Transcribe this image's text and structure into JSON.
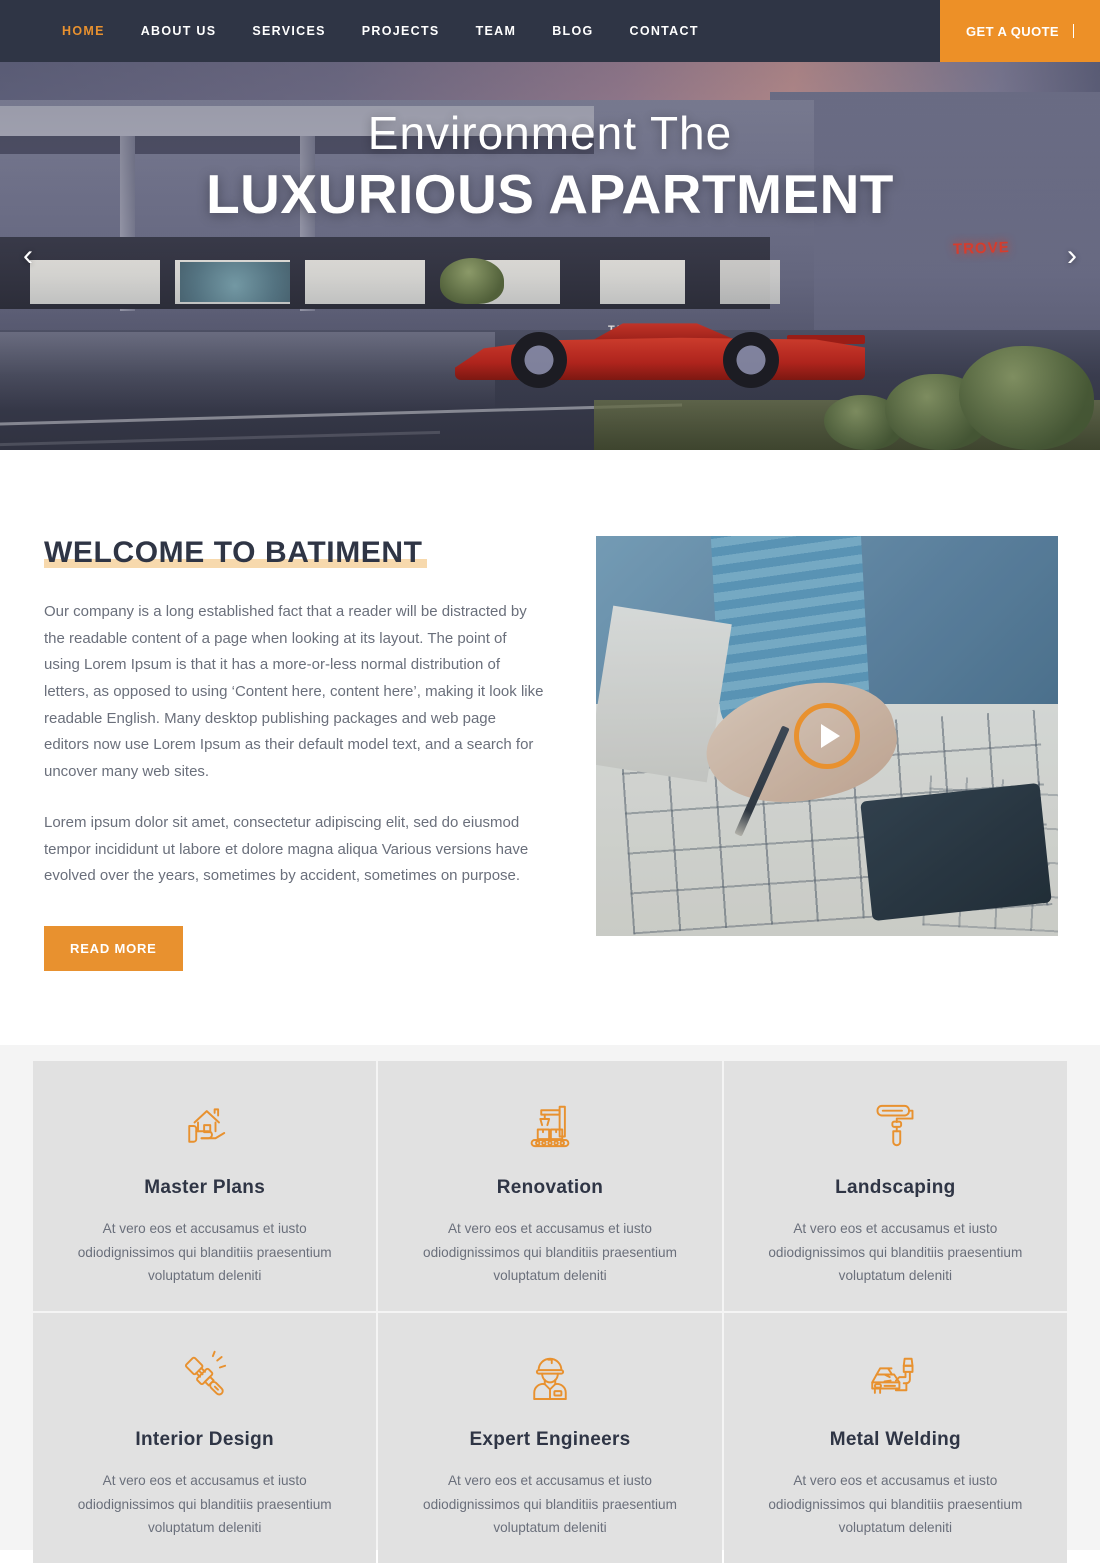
{
  "nav": {
    "items": [
      {
        "label": "HOME",
        "active": true
      },
      {
        "label": "ABOUT US",
        "active": false
      },
      {
        "label": "SERVICES",
        "active": false
      },
      {
        "label": "PROJECTS",
        "active": false
      },
      {
        "label": "TEAM",
        "active": false
      },
      {
        "label": "BLOG",
        "active": false
      },
      {
        "label": "CONTACT",
        "active": false
      }
    ],
    "quote_button": "GET A QUOTE",
    "background_color": "#2f3545",
    "accent_color": "#e8912f"
  },
  "hero": {
    "subtitle": "Environment The",
    "title": "LUXURIOUS APARTMENT",
    "prev_arrow": "‹",
    "next_arrow": "›",
    "building_sign_left": "TROVE",
    "building_sign_right": "TROVE",
    "neon_sign": "TROVE"
  },
  "welcome": {
    "heading": "WELCOME TO BATIMENT",
    "paragraph1": "Our company is a long established fact that a reader will be distracted by the readable content of a page when looking at its layout. The point of using Lorem Ipsum is that it has a more-or-less normal distribution of letters, as opposed to using ‘Content here, content here’, making it look like readable English. Many desktop publishing packages and web page editors now use Lorem Ipsum as their default model text, and a search for uncover many web sites.",
    "paragraph2": "Lorem ipsum dolor sit amet, consectetur adipiscing elit, sed do eiusmod tempor incididunt ut labore et dolore magna aliqua Various versions have evolved over the years, sometimes by accident, sometimes on purpose.",
    "read_more": "READ MORE",
    "heading_highlight_color": "#f7d9ad",
    "button_color": "#e8912f"
  },
  "services": {
    "background_color": "#f4f4f4",
    "card_color": "#e1e1e1",
    "icon_color": "#e8912f",
    "cards": [
      {
        "icon": "house-in-hand-icon",
        "title": "Master Plans",
        "desc": "At vero eos et accusamus et iusto odiodignissimos qui blanditiis praesentium voluptatum deleniti"
      },
      {
        "icon": "robotic-arm-conveyor-icon",
        "title": "Renovation",
        "desc": "At vero eos et accusamus et iusto odiodignissimos qui blanditiis praesentium voluptatum deleniti"
      },
      {
        "icon": "paint-roller-icon",
        "title": "Landscaping",
        "desc": "At vero eos et accusamus et iusto odiodignissimos qui blanditiis praesentium voluptatum deleniti"
      },
      {
        "icon": "paint-brush-icon",
        "title": "Interior Design",
        "desc": "At vero eos et accusamus et iusto odiodignissimos qui blanditiis praesentium voluptatum deleniti"
      },
      {
        "icon": "engineer-hardhat-icon",
        "title": "Expert Engineers",
        "desc": "At vero eos et accusamus et iusto odiodignissimos qui blanditiis praesentium voluptatum deleniti"
      },
      {
        "icon": "spray-gun-car-icon",
        "title": "Metal Welding",
        "desc": "At vero eos et accusamus et iusto odiodignissimos qui blanditiis praesentium voluptatum deleniti"
      }
    ]
  }
}
